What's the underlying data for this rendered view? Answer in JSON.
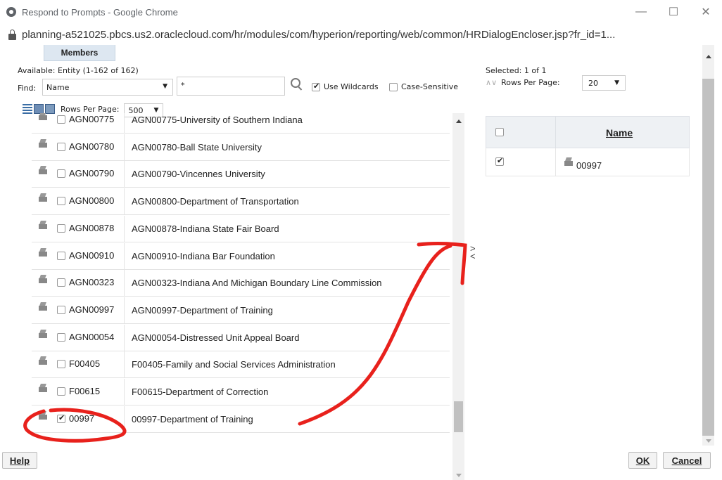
{
  "window": {
    "title": "Respond to Prompts - Google Chrome",
    "url": "planning-a521025.pbcs.us2.oraclecloud.com/hr/modules/com/hyperion/reporting/web/common/HRDialogEncloser.jsp?fr_id=1...",
    "controls": {
      "minimize": "—",
      "maximize": "☐",
      "close": "✕"
    }
  },
  "dialog": {
    "tab_label": "Members",
    "available": {
      "label": "Available:  Entity (1-162 of 162)",
      "find_label": "Find:",
      "find_by": "Name",
      "search_value": "*",
      "use_wildcards_label": "Use Wildcards",
      "use_wildcards_checked": true,
      "case_sensitive_label": "Case-Sensitive",
      "case_sensitive_checked": false,
      "rows_per_page_label": "Rows Per Page:",
      "rows_per_page": "500",
      "rows": [
        {
          "code": "AGN00775",
          "name": "AGN00775-University of Southern Indiana",
          "checked": false
        },
        {
          "code": "AGN00780",
          "name": "AGN00780-Ball State University",
          "checked": false
        },
        {
          "code": "AGN00790",
          "name": "AGN00790-Vincennes University",
          "checked": false
        },
        {
          "code": "AGN00800",
          "name": "AGN00800-Department of Transportation",
          "checked": false
        },
        {
          "code": "AGN00878",
          "name": "AGN00878-Indiana State Fair Board",
          "checked": false
        },
        {
          "code": "AGN00910",
          "name": "AGN00910-Indiana Bar Foundation",
          "checked": false
        },
        {
          "code": "AGN00323",
          "name": "AGN00323-Indiana And Michigan Boundary Line Commission",
          "checked": false
        },
        {
          "code": "AGN00997",
          "name": "AGN00997-Department of Training",
          "checked": false
        },
        {
          "code": "AGN00054",
          "name": "AGN00054-Distressed Unit Appeal Board",
          "checked": false
        },
        {
          "code": "F00405",
          "name": "F00405-Family and Social Services Administration",
          "checked": false
        },
        {
          "code": "F00615",
          "name": "F00615-Department of Correction",
          "checked": false
        },
        {
          "code": "00997",
          "name": "00997-Department of Training",
          "checked": true
        }
      ]
    },
    "selected": {
      "label": "Selected:  1 of 1",
      "rows_per_page_label": "Rows Per Page:",
      "rows_per_page": "20",
      "name_header": "Name",
      "rows": [
        {
          "code": "00997",
          "checked": true
        }
      ]
    },
    "buttons": {
      "help": "Help",
      "ok": "OK",
      "cancel": "Cancel"
    },
    "shuttle": {
      "add": ">",
      "remove": "<"
    }
  },
  "colors": {
    "annotation": "#e8211c",
    "tab_bg": "#dde7f1",
    "header_bg": "#eef1f4"
  }
}
